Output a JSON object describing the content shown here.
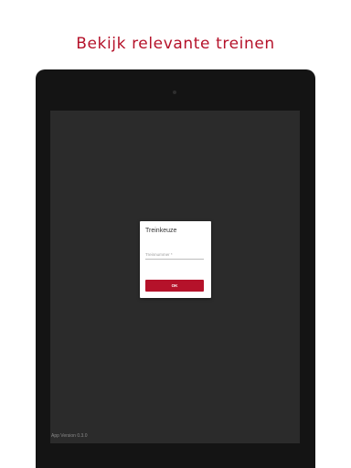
{
  "promo": {
    "title": "Bekijk relevante treinen"
  },
  "app": {
    "version_label": "App Version 0.3.0"
  },
  "dialog": {
    "title": "Treinkeuze",
    "train_number_field": {
      "placeholder": "Treinnummer *",
      "value": ""
    },
    "ok_label": "OK"
  },
  "colors": {
    "accent": "#b5122a",
    "device_bezel": "#141414",
    "screen_background": "#2b2b2b",
    "dialog_background": "#ffffff"
  }
}
